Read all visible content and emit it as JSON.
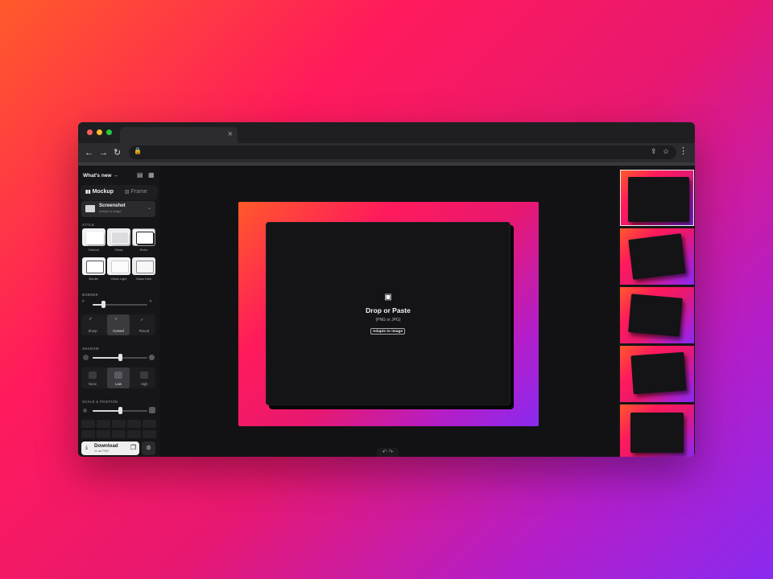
{
  "browser": {
    "tab_close": "×",
    "nav": {
      "back": "←",
      "forward": "→",
      "reload": "↻"
    },
    "url_lock": "🔒",
    "share_icon": "⇪",
    "bookmark_icon": "☆",
    "menu_icon": "⋮"
  },
  "sidebar": {
    "whats_new": "What's new →",
    "chat_icon": "▤",
    "grid_icon": "▦",
    "mode_tabs": [
      {
        "icon": "▮▮",
        "label": "Mockup",
        "active": true
      },
      {
        "icon": "▧",
        "label": "Frame",
        "active": false
      }
    ],
    "source": {
      "title": "Screenshot",
      "subtitle": "Adapts to image",
      "chevron": "⌄"
    },
    "style": {
      "label": "STYLE",
      "options": [
        "Default",
        "Glass",
        "Retro",
        "Border",
        "Glass Light",
        "Glass Dark"
      ],
      "selected": "Retro"
    },
    "border": {
      "label": "BORDER",
      "level": 0.2,
      "left_icon": "⌜",
      "right_icon": "⌝",
      "options": [
        {
          "icon": "⌜",
          "label": "Sharp"
        },
        {
          "icon": "⌜",
          "label": "Curved"
        },
        {
          "icon": "◜",
          "label": "Round"
        }
      ],
      "selected": "Curved"
    },
    "shadow": {
      "label": "SHADOW",
      "level": 0.5,
      "options": [
        "None",
        "Low",
        "High"
      ],
      "selected": "Low"
    },
    "scale_position": {
      "label": "SCALE & POSITION",
      "level": 0.5
    },
    "download": {
      "icon": "⤓",
      "title": "Download",
      "subtitle": "1x as PNG",
      "copy_icon": "❐",
      "settings_icon": "⚙"
    }
  },
  "canvas": {
    "drop_icon": "▣",
    "drop_title": "Drop or Paste",
    "drop_subtitle": "(PNG or JPG)",
    "adapt_button": "Adapts to image",
    "undo_icon": "↶",
    "redo_icon": "↷"
  },
  "colors": {
    "gradient": [
      "#ff5a2a",
      "#ff1a5c",
      "#e81870",
      "#b41ec8",
      "#8a2af0"
    ],
    "panel": "#161618",
    "canvas": "#121214"
  },
  "presets": {
    "count": 5,
    "selected_index": 0
  }
}
